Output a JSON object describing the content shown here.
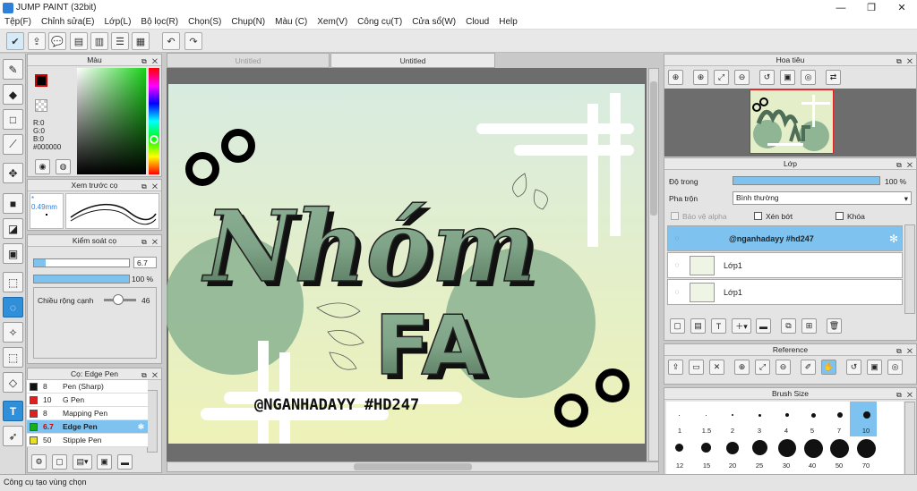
{
  "app": {
    "title": "JUMP PAINT (32bit)"
  },
  "menu": [
    "Tệp(F)",
    "Chỉnh sửa(E)",
    "Lớp(L)",
    "Bộ lọc(R)",
    "Chọn(S)",
    "Chụp(N)",
    "Màu (C)",
    "Xem(V)",
    "Công cụ(T)",
    "Cửa sổ(W)",
    "Cloud",
    "Help"
  ],
  "color_panel": {
    "title": "Màu",
    "r": "R:0",
    "g": "G:0",
    "b": "B:0",
    "hex": "#000000",
    "primary": "#000000",
    "secondary": "#ffffff"
  },
  "preview_panel": {
    "title": "Xem trước cọ",
    "size": "* 0.49mm"
  },
  "brush_control": {
    "title": "Kiểm soát cọ",
    "size_value": "6.7",
    "opacity_value": "100 %",
    "width_label": "Chiều rộng cạnh",
    "width_value": "46"
  },
  "brush_list": {
    "title": "Cọ: Edge Pen",
    "items": [
      {
        "size": "8",
        "name": "Pen (Sharp)",
        "color": "#111111",
        "selected": false
      },
      {
        "size": "10",
        "name": "G Pen",
        "color": "#e02020",
        "selected": false
      },
      {
        "size": "8",
        "name": "Mapping Pen",
        "color": "#e02020",
        "selected": false
      },
      {
        "size": "6.7",
        "name": "Edge Pen",
        "color": "#18b018",
        "selected": true
      },
      {
        "size": "50",
        "name": "Stipple Pen",
        "color": "#e8e020",
        "selected": false
      }
    ]
  },
  "tabs": [
    "Untitled",
    "Untitled"
  ],
  "artwork": {
    "title_line1": "Nhóm",
    "title_line2": "FA",
    "tagline": "@NGANHADAYY #HD247"
  },
  "navigator": {
    "title": "Hoa tiêu"
  },
  "layers": {
    "title": "Lớp",
    "opacity_label": "Độ trong",
    "opacity_value": "100 %",
    "blend_label": "Pha trộn",
    "blend_value": "Bình thường",
    "protect_alpha": "Bảo vệ alpha",
    "clip": "Xén bớt",
    "lock": "Khóa",
    "items": [
      {
        "name": "@nganhadayy #hd247",
        "selected": true
      },
      {
        "name": "Lớp1",
        "selected": false
      },
      {
        "name": "Lớp1",
        "selected": false
      }
    ]
  },
  "reference": {
    "title": "Reference"
  },
  "brush_size": {
    "title": "Brush Size",
    "row1": [
      "1",
      "1.5",
      "2",
      "3",
      "4",
      "5",
      "7",
      "10"
    ],
    "row2": [
      "12",
      "15",
      "20",
      "25",
      "30",
      "40",
      "50",
      "70"
    ]
  },
  "status": {
    "text": "Công cụ tạo vùng chọn"
  }
}
